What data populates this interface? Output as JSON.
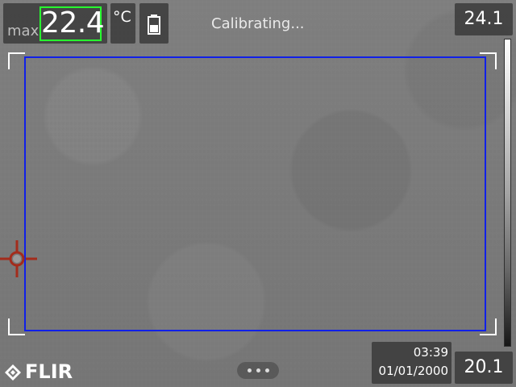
{
  "measurement": {
    "max_label": "max",
    "max_value": "22.4",
    "unit": "°C"
  },
  "status": {
    "text": "Calibrating..."
  },
  "scale": {
    "upper": "24.1",
    "lower": "20.1"
  },
  "datetime": {
    "time": "03:39",
    "date": "01/01/2000"
  },
  "brand": {
    "logo_text": "FLIR"
  },
  "icons": {
    "battery": "battery-icon",
    "crosshair": "spot-crosshair-icon",
    "more": "more-options-icon",
    "logo": "flir-logo-icon"
  },
  "colors": {
    "max_highlight": "#27ff2f",
    "measurement_box": "#1020e8",
    "crosshair": "#a32c1c"
  }
}
